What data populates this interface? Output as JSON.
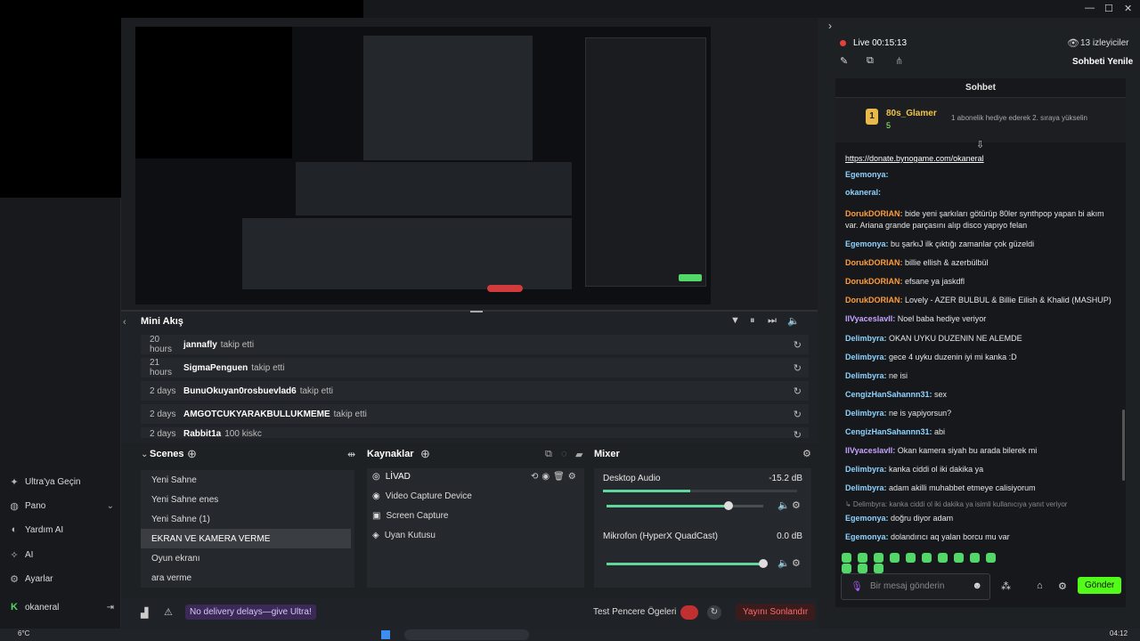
{
  "sidebar": {
    "items": [
      {
        "label": "Ultra'ya Geçin",
        "icon": "sparkle-icon"
      },
      {
        "label": "Pano",
        "icon": "palette-icon"
      },
      {
        "label": "Yardım AI",
        "icon": "help-icon"
      },
      {
        "label": "AI",
        "icon": "ai-icon"
      },
      {
        "label": "Ayarlar",
        "icon": "gear-icon"
      }
    ],
    "user": "okaneral",
    "delivery_badge": "No delivery delays—give Ultra!"
  },
  "mini_feed": {
    "title": "Mini Akış",
    "rows": [
      {
        "time": "20 hours",
        "user": "jannafly",
        "action": "takip etti"
      },
      {
        "time": "21 hours",
        "user": "SigmaPenguen",
        "action": "takip etti"
      },
      {
        "time": "2 days",
        "user": "BunuOkuyan0rosbuevlad6",
        "action": "takip etti"
      },
      {
        "time": "2 days",
        "user": "AMGOTCUKYARAKBULLUKMEME",
        "action": "takip etti"
      },
      {
        "time": "2 days",
        "user": "Rabbit1a",
        "action": "100 kiskc"
      }
    ]
  },
  "scenes": {
    "title": "Scenes",
    "items": [
      "Yeni Sahne",
      "Yeni Sahne enes",
      "Yeni Sahne (1)",
      "EKRAN VE KAMERA VERME",
      "Oyun ekranı",
      "ara verme"
    ],
    "selected_index": 3
  },
  "sources": {
    "title": "Kaynaklar",
    "items": [
      "LİVAD",
      "Video Capture Device",
      "Screen Capture",
      "Uyan Kutusu"
    ]
  },
  "mixer": {
    "title": "Mixer",
    "channels": [
      {
        "name": "Desktop Audio",
        "db": "-15.2 dB",
        "level": 0.45,
        "volume": 0.78
      },
      {
        "name": "Mikrofon (HyperX QuadCast)",
        "db": "0.0 dB",
        "level": 0.0,
        "volume": 1.0
      }
    ]
  },
  "footer": {
    "test_label": "Test Pencere Ögeleri",
    "end_stream": "Yayını Sonlandır"
  },
  "stream": {
    "live": "Live 00:15:13",
    "viewers": "13 izleyiciler",
    "refresh_chat": "Sohbeti Yenile",
    "chat_title": "Sohbet"
  },
  "pinned": {
    "user": "80s_Glamer",
    "count": "5",
    "text": "1 abonelik hediye ederek 2. sıraya yükselin"
  },
  "chat": [
    {
      "user": "",
      "text": "https://donate.bynogame.com/okaneral",
      "color": "#ffffff",
      "link": true
    },
    {
      "user": "Egemonya:",
      "text": "",
      "color": "#8fd3ff"
    },
    {
      "user": "okaneral:",
      "text": "",
      "color": "#8fd3ff"
    },
    {
      "user": "DorukDORIAN:",
      "text": "bide yeni şarkıları götürüp 80ler synthpop yapan bi akım var. Ariana grande parçasını alıp disco yapıyo felan",
      "color": "#ff9d3b"
    },
    {
      "user": "Egemonya:",
      "text": "bu şarkıJ ilk çıktığı zamanlar çok güzeldi",
      "color": "#8fd3ff"
    },
    {
      "user": "DorukDORIAN:",
      "text": "billie ellish & azerbülbül",
      "color": "#ff9d3b"
    },
    {
      "user": "DorukDORIAN:",
      "text": "efsane ya jaskdfl",
      "color": "#ff9d3b"
    },
    {
      "user": "DorukDORIAN:",
      "text": "Lovely - AZER BULBUL & Billie Eilish & Khalid (MASHUP)",
      "color": "#ff9d3b"
    },
    {
      "user": "IlVyaceslavIl:",
      "text": "Noel baba hediye veriyor",
      "color": "#c7a4ff"
    },
    {
      "user": "Delimbyra:",
      "text": "OKAN UYKU DUZENIN NE ALEMDE",
      "color": "#8fd3ff"
    },
    {
      "user": "Delimbyra:",
      "text": "gece 4 uyku duzenin iyi mi kanka :D",
      "color": "#8fd3ff"
    },
    {
      "user": "Delimbyra:",
      "text": "ne isi",
      "color": "#8fd3ff"
    },
    {
      "user": "CengizHanSahannn31:",
      "text": "sex",
      "color": "#8fd3ff"
    },
    {
      "user": "Delimbyra:",
      "text": "ne is yapiyorsun?",
      "color": "#8fd3ff"
    },
    {
      "user": "CengizHanSahannn31:",
      "text": "abi",
      "color": "#8fd3ff"
    },
    {
      "user": "IlVyaceslavIl:",
      "text": "Okan kamera siyah bu arada bilerek mi",
      "color": "#c7a4ff"
    },
    {
      "user": "Delimbyra:",
      "text": "kanka ciddi ol iki dakika ya",
      "color": "#8fd3ff"
    },
    {
      "user": "Delimbyra:",
      "text": "adam akilli muhabbet etmeye calisiyorum",
      "color": "#8fd3ff"
    },
    {
      "user": "",
      "text": "↳ Delimbyra: kanka ciddi ol iki dakika ya isimli kullanıcıya yanıt veriyor",
      "color": "#888888",
      "reply": true
    },
    {
      "user": "Egemonya:",
      "text": "doğru diyor adam",
      "color": "#8fd3ff"
    },
    {
      "user": "Egemonya:",
      "text": "dolandırıcı aq yalan borcu mu var",
      "color": "#8fd3ff"
    }
  ],
  "chat_input": {
    "placeholder": "Bir mesaj gönderin",
    "send": "Gönder"
  },
  "taskbar": {
    "temp": "6°C",
    "time": "04:12"
  }
}
